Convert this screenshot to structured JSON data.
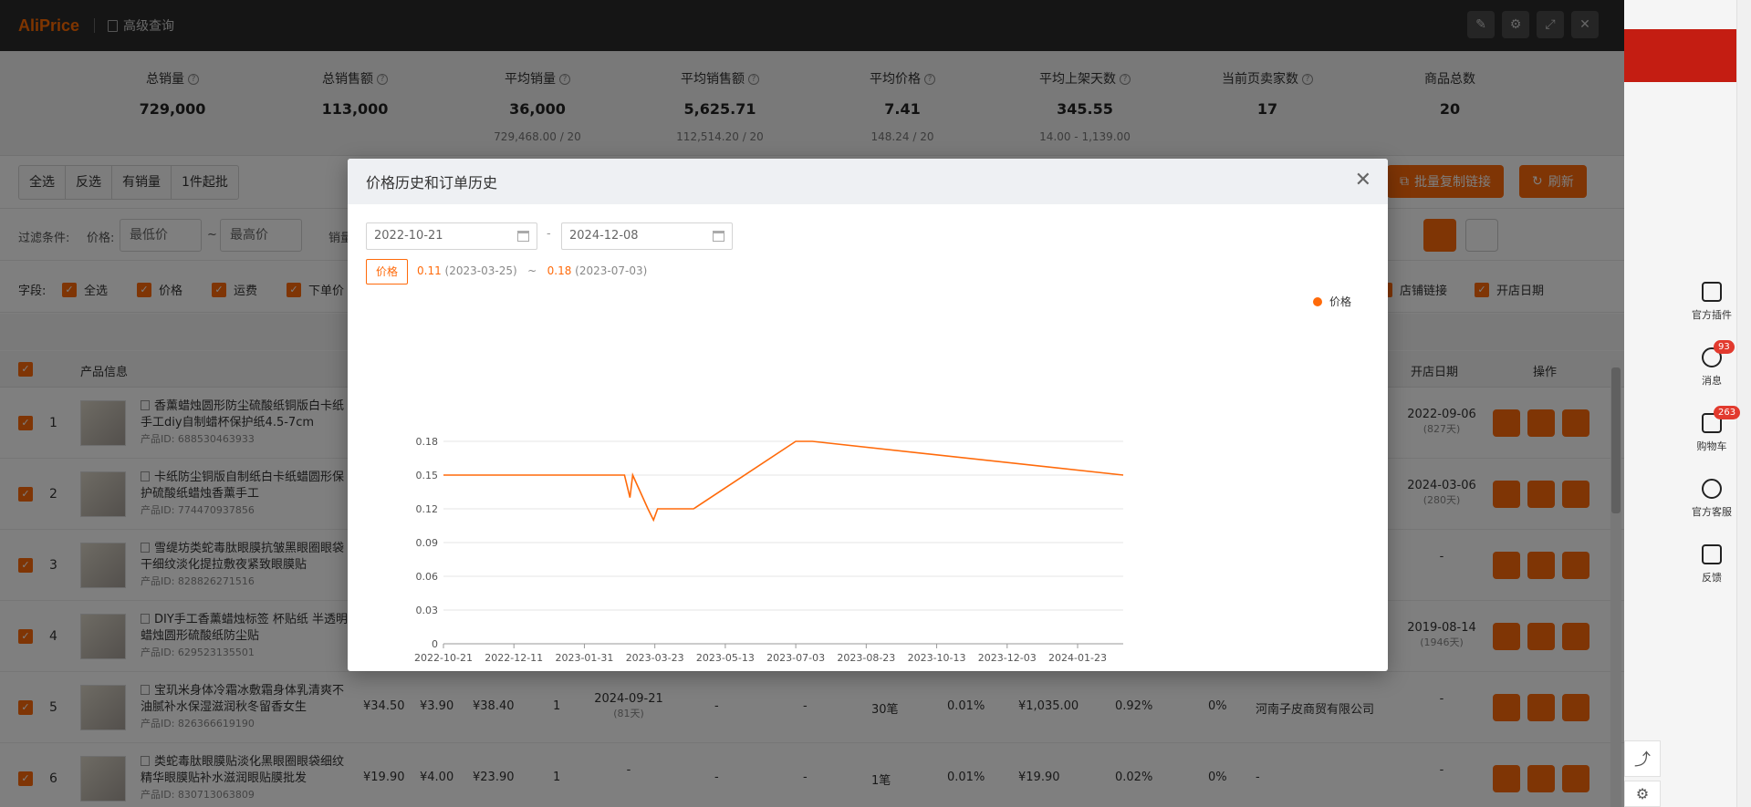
{
  "app": {
    "logo": "AliPrice",
    "section": "高级查询"
  },
  "stats": [
    {
      "label": "总销量",
      "value": "729,000",
      "sub": ""
    },
    {
      "label": "总销售额",
      "value": "113,000",
      "sub": ""
    },
    {
      "label": "平均销量",
      "value": "36,000",
      "sub": "729,468.00 / 20"
    },
    {
      "label": "平均销售额",
      "value": "5,625.71",
      "sub": "112,514.20 / 20"
    },
    {
      "label": "平均价格",
      "value": "7.41",
      "sub": "148.24 / 20"
    },
    {
      "label": "平均上架天数",
      "value": "345.55",
      "sub": "14.00 - 1,139.00"
    },
    {
      "label": "当前页卖家数",
      "value": "17",
      "sub": ""
    },
    {
      "label": "商品总数",
      "value": "20",
      "sub": ""
    }
  ],
  "toolbar": {
    "buttons": [
      "全选",
      "反选",
      "有销量",
      "1件起批"
    ],
    "batch_copy": "批量复制链接",
    "refresh": "刷新"
  },
  "filter": {
    "label": "过滤条件:",
    "price_label": "价格:",
    "min_price": "最低价",
    "max_price": "最高价",
    "tilde": "~",
    "sales_label": "销量"
  },
  "fields": {
    "label": "字段:",
    "items": [
      "全选",
      "价格",
      "运费",
      "下单价"
    ],
    "right_items": [
      "店铺链接",
      "开店日期"
    ]
  },
  "table": {
    "headers": {
      "info": "产品信息",
      "open_date": "开店日期",
      "ops": "操作"
    },
    "rows": [
      {
        "n": "1",
        "title": "香薰蜡烛圆形防尘硫酸纸铜版白卡纸手工diy自制蜡杯保护纸4.5-7cm",
        "pid": "产品ID: 688530463933",
        "open": "2022-09-06",
        "open_days": "(827天)"
      },
      {
        "n": "2",
        "title": "卡纸防尘铜版自制纸白卡纸蜡圆形保护硫酸纸蜡烛香薰手工",
        "pid": "产品ID: 774470937856",
        "open": "2024-03-06",
        "open_days": "(280天)"
      },
      {
        "n": "3",
        "title": "雪缇坊类蛇毒肽眼膜抗皱黑眼圈眼袋干细纹淡化提拉敷夜紧致眼膜贴",
        "pid": "产品ID: 828826271516",
        "open": "-",
        "open_days": ""
      },
      {
        "n": "4",
        "title": "DIY手工香薰蜡烛标签 杯贴纸 半透明蜡烛圆形硫酸纸防尘贴",
        "pid": "产品ID: 629523135501",
        "open": "2019-08-14",
        "open_days": "(1946天)"
      },
      {
        "n": "5",
        "title": "宝玑米身体冷霜冰敷霜身体乳清爽不油腻补水保湿滋润秋冬留香女生",
        "pid": "产品ID: 826366619190",
        "price": "¥34.50",
        "ship": "¥3.90",
        "order": "¥38.40",
        "moq": "1",
        "date": "2024-09-21",
        "date_days": "(81天)",
        "d1": "-",
        "d2": "-",
        "sold": "30笔",
        "rate": "0.01%",
        "amount": "¥1,035.00",
        "r2": "0.92%",
        "r3": "0%",
        "shop": "河南子皮商贸有限公司",
        "open": "-",
        "open_days": ""
      },
      {
        "n": "6",
        "title": "类蛇毒肽眼膜贴淡化黑眼圈眼袋细纹精华眼膜贴补水滋润眼贴膜批发",
        "pid": "产品ID: 830713063809",
        "price": "¥19.90",
        "ship": "¥4.00",
        "order": "¥23.90",
        "moq": "1",
        "date": "-",
        "date_days": "",
        "d1": "-",
        "d2": "-",
        "sold": "1笔",
        "rate": "0.01%",
        "amount": "¥19.90",
        "r2": "0.02%",
        "r3": "0%",
        "shop": "-",
        "open": "-",
        "open_days": ""
      }
    ]
  },
  "side": {
    "tools": [
      {
        "label": "官方插件",
        "badge": ""
      },
      {
        "label": "消息",
        "badge": "93"
      },
      {
        "label": "购物车",
        "badge": "263"
      },
      {
        "label": "官方客服",
        "badge": ""
      },
      {
        "label": "反馈",
        "badge": ""
      }
    ]
  },
  "modal": {
    "title": "价格历史和订单历史",
    "date_from": "2022-10-21",
    "date_to": "2024-12-08",
    "dash": "-",
    "tag": "价格",
    "min_value": "0.11",
    "min_date": "(2023-03-25)",
    "tilde": "~",
    "max_value": "0.18",
    "max_date": "(2023-07-03)",
    "legend": "价格"
  },
  "chart_data": {
    "type": "line",
    "x_ticks": [
      "2022-10-21",
      "2022-12-11",
      "2023-01-31",
      "2023-03-23",
      "2023-05-13",
      "2023-07-03",
      "2023-08-23",
      "2023-10-13",
      "2023-12-03",
      "2024-01-23"
    ],
    "y_ticks": [
      "0",
      "0.03",
      "0.06",
      "0.09",
      "0.12",
      "0.15",
      "0.18"
    ],
    "ylim": [
      0,
      0.18
    ],
    "xlim": [
      "2022-10-21",
      "2024-02-25"
    ],
    "grid": true,
    "legend_position": "top-right",
    "color": "#ff6a0a",
    "series": [
      {
        "name": "价格",
        "points": [
          [
            "2022-10-21",
            0.15
          ],
          [
            "2023-03-01",
            0.15
          ],
          [
            "2023-03-05",
            0.13
          ],
          [
            "2023-03-07",
            0.15
          ],
          [
            "2023-03-18",
            0.12
          ],
          [
            "2023-03-22",
            0.11
          ],
          [
            "2023-03-25",
            0.12
          ],
          [
            "2023-04-20",
            0.12
          ],
          [
            "2023-07-03",
            0.18
          ],
          [
            "2023-07-15",
            0.18
          ],
          [
            "2024-02-25",
            0.15
          ]
        ]
      }
    ]
  }
}
